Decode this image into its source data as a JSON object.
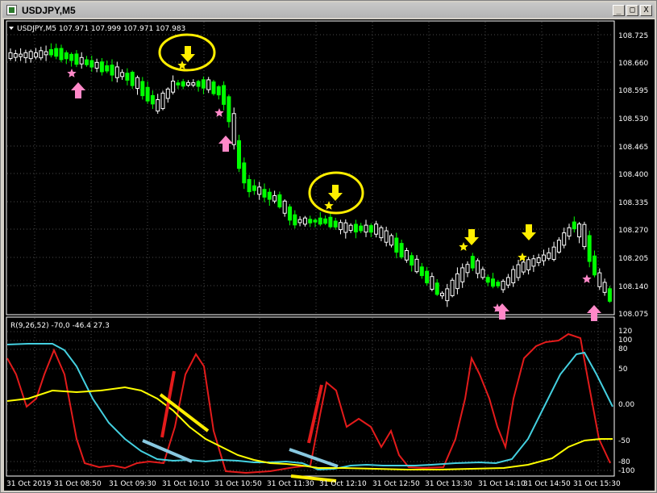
{
  "window": {
    "title": "USDJPY,M5",
    "minimize_glyph": "_",
    "maximize_glyph": "□",
    "close_glyph": "X"
  },
  "main_chart": {
    "info": "USDJPY,M5  107.971 107.999 107.971 107.983",
    "price_labels": [
      "108.725",
      "108.660",
      "108.595",
      "108.530",
      "108.465",
      "108.400",
      "108.335",
      "108.270",
      "108.205",
      "108.140",
      "108.075"
    ]
  },
  "indicator": {
    "info": "R(9,26,52) -70,0 -46.4 27.3",
    "level_labels": [
      "120",
      "100",
      "80",
      "50",
      "0.00",
      "-50",
      "-80",
      "-100"
    ]
  },
  "time_labels": [
    "31 Oct 2019",
    "31 Oct 08:50",
    "31 Oct 09:30",
    "31 Oct 10:10",
    "31 Oct 10:50",
    "31 Oct 11:30",
    "31 Oct 12:10",
    "31 Oct 12:50",
    "31 Oct 13:30",
    "31 Oct 14:10",
    "31 Oct 14:50",
    "31 Oct 15:30"
  ],
  "colors": {
    "background": "#000000",
    "bull": "#ffffff",
    "bear": "#00ff00",
    "grid": "#4a4a4a",
    "axis_text": "#ffffff",
    "red_line": "#e31b1b",
    "cyan_line": "#44d0e0",
    "yellow_line": "#ffff00",
    "pink_arrow": "#ff88c8",
    "yellow_arrow": "#ffee00"
  },
  "icons": {
    "buy_marker": "pink-up-arrow-icon",
    "sell_marker": "yellow-down-arrow-icon",
    "star_marker": "star-icon"
  }
}
